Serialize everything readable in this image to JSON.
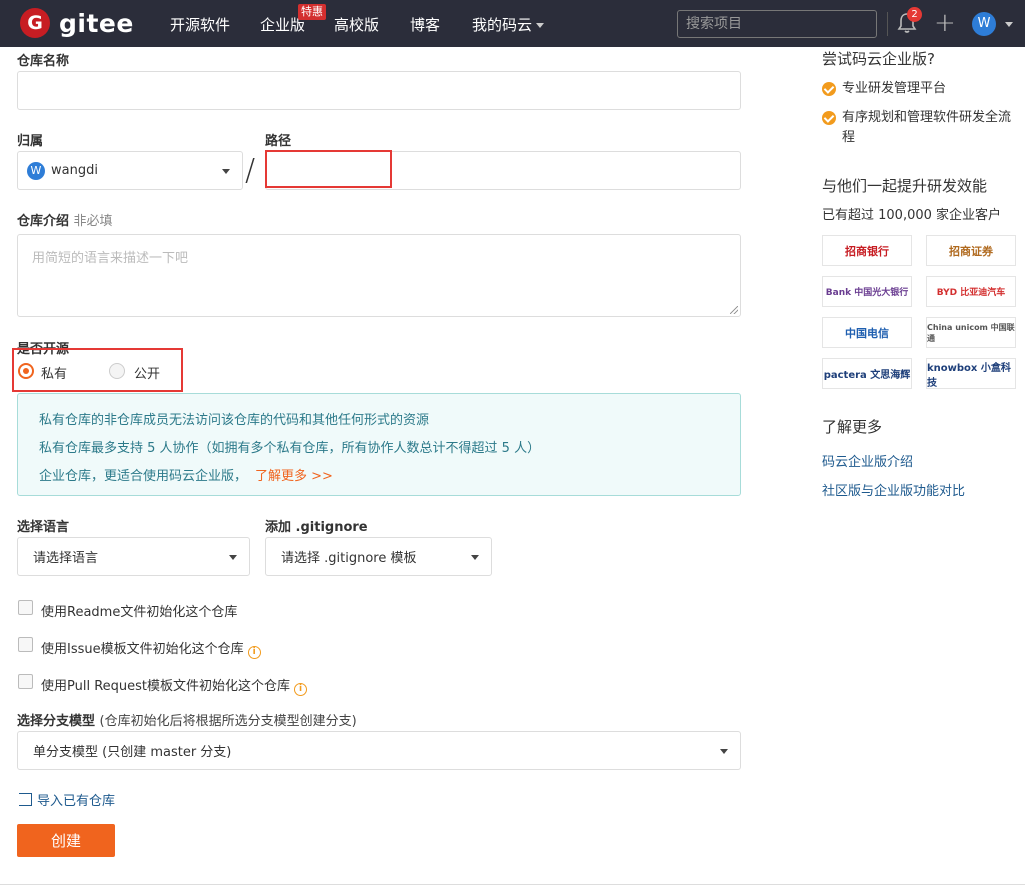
{
  "nav": {
    "brand": "gitee",
    "logo_letter": "G",
    "items": [
      "开源软件",
      "企业版",
      "高校版",
      "博客",
      "我的码云"
    ],
    "badge": "特惠",
    "search_placeholder": "搜索项目",
    "notification_count": "2",
    "plus": "+",
    "user_initial": "W"
  },
  "form": {
    "repo_name_label": "仓库名称",
    "owner_label": "归属",
    "owner_value": "wangdi",
    "owner_initial": "W",
    "path_label": "路径",
    "slash": "/",
    "desc_label": "仓库介绍",
    "desc_optional": "非必填",
    "desc_placeholder": "用简短的语言来描述一下吧",
    "open_label": "是否开源",
    "private_label": "私有",
    "public_label": "公开",
    "info_lines": [
      "私有仓库的非仓库成员无法访问该仓库的代码和其他任何形式的资源",
      "私有仓库最多支持 5 人协作（如拥有多个私有仓库，所有协作人数总计不得超过 5 人）",
      "企业仓库，更适合使用码云企业版，"
    ],
    "info_link": "了解更多 >>",
    "language_label": "选择语言",
    "language_value": "请选择语言",
    "gitignore_label": "添加 .gitignore",
    "gitignore_value": "请选择 .gitignore 模板",
    "checkboxes": [
      "使用Readme文件初始化这个仓库",
      "使用Issue模板文件初始化这个仓库",
      "使用Pull Request模板文件初始化这个仓库"
    ],
    "branch_label": "选择分支模型",
    "branch_hint": "(仓库初始化后将根据所选分支模型创建分支)",
    "branch_value": "单分支模型 (只创建 master 分支)",
    "import_link": "导入已有仓库",
    "create_button": "创建",
    "info_glyph": "i"
  },
  "sidebar": {
    "try_title": "尝试码云企业版?",
    "features": [
      "专业研发管理平台",
      "有序规划和管理软件研发全流程"
    ],
    "improve_title": "与他们一起提升研发效能",
    "customers_text": "已有超过 100,000 家企业客户",
    "logos": [
      "招商银行",
      "招商证券",
      "Bank 中国光大银行",
      "BYD 比亚迪汽车",
      "中国电信",
      "China unicom 中国联通",
      "pactera 文思海辉",
      "knowbox 小盒科技"
    ],
    "learn_title": "了解更多",
    "links": [
      "码云企业版介绍",
      "社区版与企业版功能对比"
    ]
  },
  "colors": {
    "nav_bg": "#2b2d3a",
    "accent": "#f0641e",
    "brand_red": "#c71d23",
    "link": "#1e5a8e",
    "highlight_box": "#e53935"
  }
}
